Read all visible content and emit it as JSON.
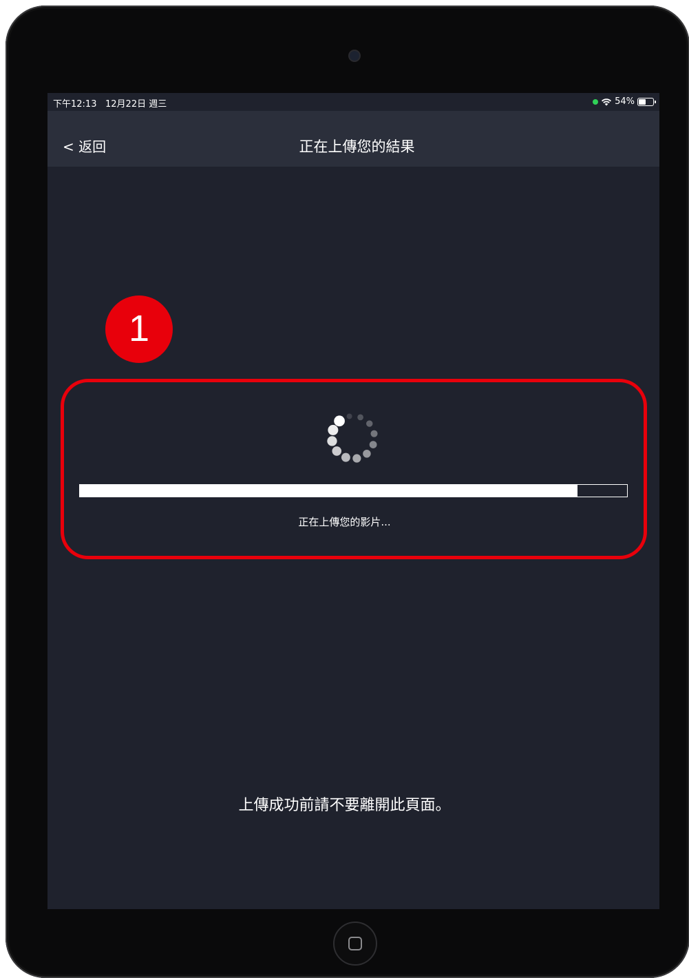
{
  "status_bar": {
    "time": "下午12:13",
    "date": "12月22日 週三",
    "battery": "54%",
    "battery_level": 0.54,
    "wifi_icon": "wifi-icon",
    "indicator_color": "#30d158"
  },
  "nav": {
    "back_label": "< 返回",
    "title": "正在上傳您的結果"
  },
  "callout": {
    "number": "1",
    "color": "#e8000b"
  },
  "upload": {
    "progress": 0.91,
    "status_text": "正在上傳您的影片..."
  },
  "footer": {
    "notice": "上傳成功前請不要離開此頁面。"
  },
  "colors": {
    "screen_bg": "#1f222d",
    "nav_bg": "#2b2f3b",
    "accent_red": "#e8000b"
  }
}
